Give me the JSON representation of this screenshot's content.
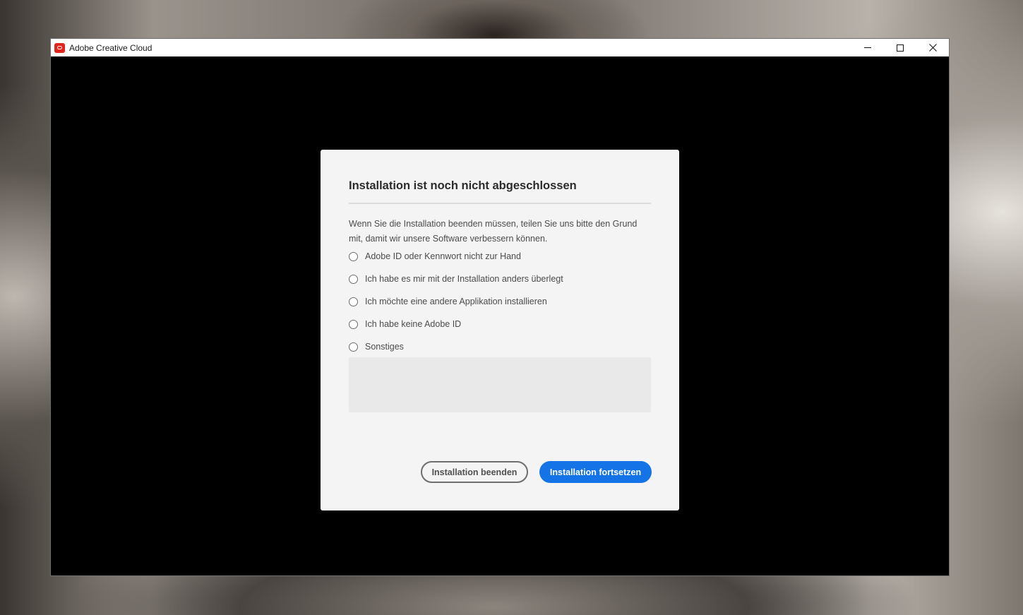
{
  "window": {
    "title": "Adobe Creative Cloud",
    "controls": {
      "minimize": "minimize-icon",
      "maximize": "maximize-icon",
      "close": "close-icon"
    }
  },
  "dialog": {
    "title": "Installation ist noch nicht abgeschlossen",
    "description": "Wenn Sie die Installation beenden müssen, teilen Sie uns bitte den Grund mit, damit wir unsere Software verbessern können.",
    "options": [
      {
        "label": "Adobe ID oder Kennwort nicht zur Hand",
        "selected": false
      },
      {
        "label": "Ich habe es mir mit der Installation anders überlegt",
        "selected": false
      },
      {
        "label": "Ich möchte eine andere Applikation installieren",
        "selected": false
      },
      {
        "label": "Ich habe keine Adobe ID",
        "selected": false
      },
      {
        "label": "Sonstiges",
        "selected": false
      }
    ],
    "feedback_value": "",
    "buttons": {
      "cancel": "Installation beenden",
      "continue": "Installation fortsetzen"
    }
  },
  "colors": {
    "accent": "#1473e6",
    "brand": "#e1251b",
    "dialog_bg": "#f4f4f4"
  }
}
